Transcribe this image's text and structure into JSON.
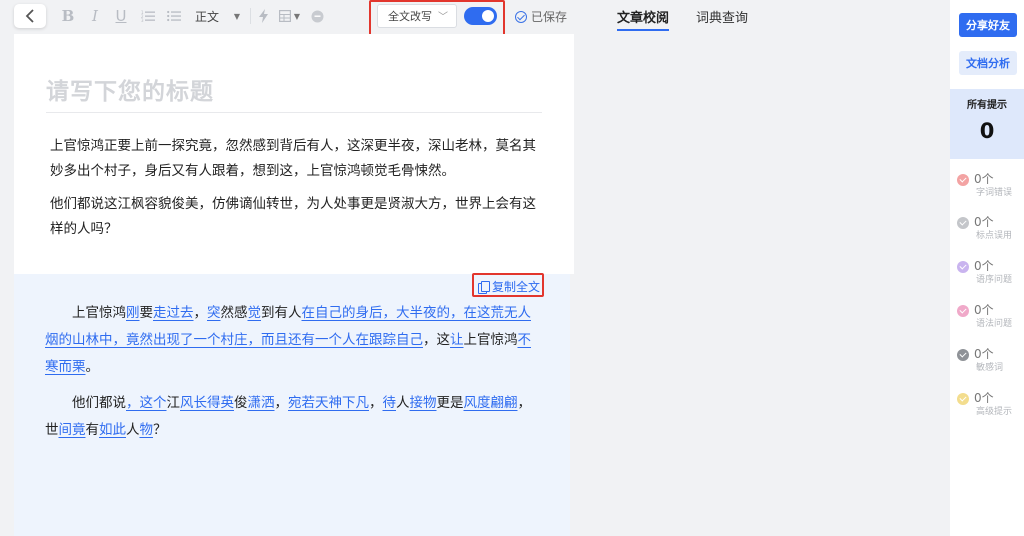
{
  "toolbar": {
    "format_label": "正文",
    "rewrite_mode": "全文改写",
    "rewrite_enabled": true,
    "saved_label": "已保存"
  },
  "tabs": [
    {
      "label": "文章校阅",
      "active": true
    },
    {
      "label": "词典查询",
      "active": false
    }
  ],
  "doc": {
    "title_placeholder": "请写下您的标题",
    "paragraphs": [
      "上官惊鸿正要上前一探究竟，忽然感到背后有人，这深更半夜，深山老林，莫名其妙多出个村子，身后又有人跟着，想到这，上官惊鸿顿觉毛骨悚然。",
      "他们都说这江枫容貌俊美，仿佛谪仙转世，为人处事更是贤淑大方，世界上会有这样的人吗？"
    ]
  },
  "result": {
    "copy_label": "复制全文",
    "paragraphs": [
      [
        {
          "t": "上官惊鸿",
          "h": false
        },
        {
          "t": "刚",
          "h": true
        },
        {
          "t": "要",
          "h": false
        },
        {
          "t": "走过去",
          "h": true
        },
        {
          "t": "，",
          "h": false
        },
        {
          "t": "突",
          "h": true
        },
        {
          "t": "然感",
          "h": false
        },
        {
          "t": "觉",
          "h": true
        },
        {
          "t": "到有人",
          "h": false
        },
        {
          "t": "在自己的身后，大半夜的，在这荒无人烟的山林中，竟然出现了一个村庄，而且还有一个人在跟踪自己",
          "h": true
        },
        {
          "t": "，这",
          "h": false
        },
        {
          "t": "让",
          "h": true
        },
        {
          "t": "上官惊鸿",
          "h": false
        },
        {
          "t": "不寒而栗",
          "h": true
        },
        {
          "t": "。",
          "h": false
        }
      ],
      [
        {
          "t": "他们都说",
          "h": false
        },
        {
          "t": "，这",
          "h": true
        },
        {
          "t": "个",
          "h": true
        },
        {
          "t": "江",
          "h": false
        },
        {
          "t": "风长得英",
          "h": true
        },
        {
          "t": "俊",
          "h": false
        },
        {
          "t": "潇洒",
          "h": true
        },
        {
          "t": "，",
          "h": false
        },
        {
          "t": "宛若天神下凡",
          "h": true
        },
        {
          "t": "，",
          "h": false
        },
        {
          "t": "待",
          "h": true
        },
        {
          "t": "人",
          "h": false
        },
        {
          "t": "接物",
          "h": true
        },
        {
          "t": "更是",
          "h": false
        },
        {
          "t": "风度翩翩",
          "h": true
        },
        {
          "t": "，世",
          "h": false
        },
        {
          "t": "间竟",
          "h": true
        },
        {
          "t": "有",
          "h": false
        },
        {
          "t": "如此",
          "h": true
        },
        {
          "t": "人",
          "h": false
        },
        {
          "t": "物",
          "h": true
        },
        {
          "t": "？",
          "h": false
        }
      ]
    ]
  },
  "panel": {
    "share_label": "分享好友",
    "analysis_label": "文档分析",
    "all_tips_label": "所有提示",
    "all_tips_count": "0",
    "items": [
      {
        "count": "0个",
        "label": "字词错误",
        "color": "#f3a3a3"
      },
      {
        "count": "0个",
        "label": "标点误用",
        "color": "#c4c6ca"
      },
      {
        "count": "0个",
        "label": "语序问题",
        "color": "#c9b4ef"
      },
      {
        "count": "0个",
        "label": "语法问题",
        "color": "#f0a9c9"
      },
      {
        "count": "0个",
        "label": "敏感词",
        "color": "#8f9297"
      },
      {
        "count": "0个",
        "label": "高级提示",
        "color": "#f3dd8e"
      }
    ]
  },
  "icons": {
    "back": "chevron-left-icon",
    "bold": "bold-icon",
    "italic": "italic-icon",
    "underline": "underline-icon",
    "ordered_list": "ordered-list-icon",
    "bullet_list": "bullet-list-icon",
    "flash": "flash-icon",
    "table": "table-icon",
    "quote": "quote-icon",
    "copy": "copy-icon",
    "saved": "check-circle-icon"
  },
  "colors": {
    "accent": "#2f6cf0",
    "highlight_box": "#e2362d",
    "result_bg": "#eef4fd"
  }
}
